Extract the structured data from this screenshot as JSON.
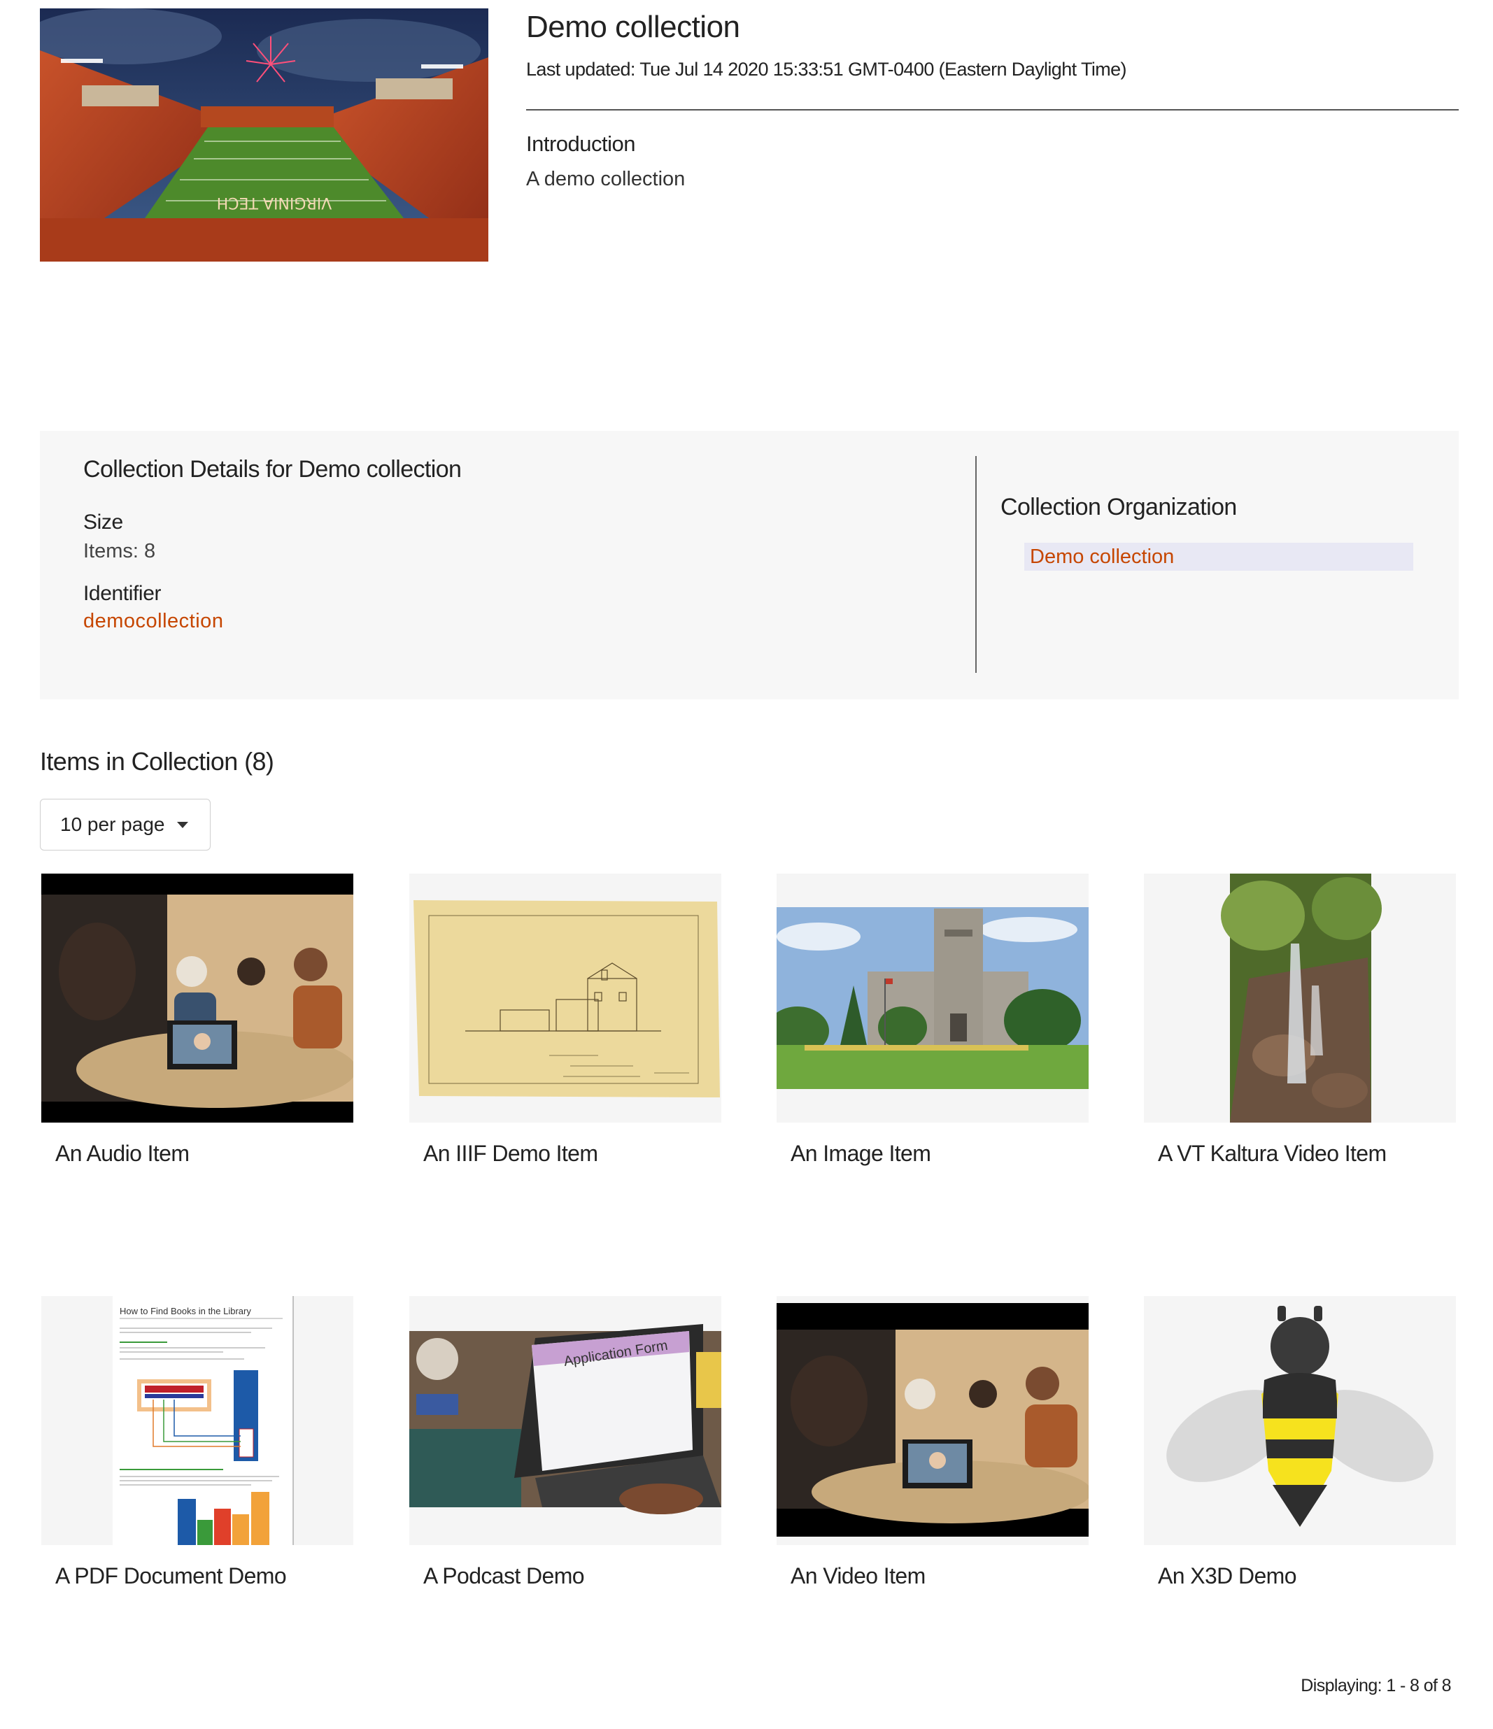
{
  "collection": {
    "title": "Demo collection",
    "last_updated": "Last updated: Tue Jul 14 2020 15:33:51 GMT-0400 (Eastern Daylight Time)",
    "intro_heading": "Introduction",
    "intro_text": "A demo collection",
    "hero_image_alt": "stadium-photo"
  },
  "details": {
    "title": "Collection Details for Demo collection",
    "size_label": "Size",
    "size_value": "Items: 8",
    "identifier_label": "Identifier",
    "identifier_value": "democollection",
    "org_title": "Collection Organization",
    "org_item": "Demo collection"
  },
  "items": {
    "heading": "Items in Collection (8)",
    "per_page": "10 per page",
    "list": [
      {
        "title": "An Audio Item",
        "thumb": "meeting-video-thumbnail"
      },
      {
        "title": "An IIIF Demo Item",
        "thumb": "architectural-drawing-thumbnail"
      },
      {
        "title": "An Image Item",
        "thumb": "building-photo-thumbnail"
      },
      {
        "title": "A VT Kaltura Video Item",
        "thumb": "waterfall-thumbnail"
      },
      {
        "title": "A PDF Document Demo",
        "thumb": "pdf-page-thumbnail"
      },
      {
        "title": "A Podcast Demo",
        "thumb": "laptop-form-thumbnail"
      },
      {
        "title": "An Video Item",
        "thumb": "meeting-video-thumbnail"
      },
      {
        "title": "An X3D Demo",
        "thumb": "bee-model-thumbnail"
      }
    ],
    "pdf_thumb_title": "How to Find Books in the Library",
    "podcast_thumb_text": "Application Form",
    "stadium_text": "VIRGINIA TECH"
  },
  "footer": {
    "displaying": "Displaying: 1 - 8 of 8"
  },
  "colors": {
    "link": "#c64600",
    "panel_bg": "#f7f7f7",
    "org_highlight": "#e8e8f4"
  }
}
